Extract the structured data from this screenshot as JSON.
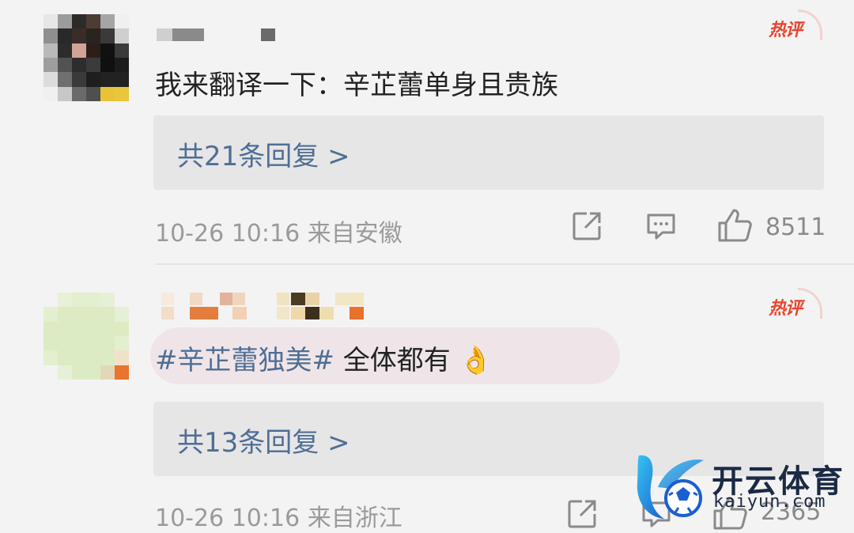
{
  "comments": [
    {
      "badge": "热评",
      "text": "我来翻译一下：辛芷蕾单身且贵族",
      "replies_label": "共21条回复 >",
      "meta": "10-26 10:16 来自安徽",
      "likes": "8511"
    },
    {
      "badge": "热评",
      "topic": "#辛芷蕾独美#",
      "text": " 全体都有",
      "emoji": "👌",
      "replies_label": "共13条回复 >",
      "meta": "10-26 10:16 来自浙江",
      "likes": "2365"
    }
  ],
  "watermark": {
    "name": "开云体育",
    "domain": "kaiyun.com"
  },
  "colors": {
    "link": "#4f6e95",
    "hot": "#e8452c",
    "meta": "#9a9a9a"
  },
  "icons": [
    "share-icon",
    "comment-icon",
    "like-icon"
  ]
}
